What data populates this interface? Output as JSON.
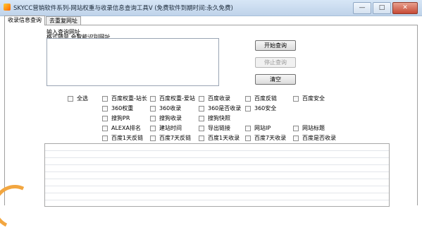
{
  "window": {
    "title": "SKYCC营销软件系列-网站权重与收录信息查询工具V (免费软件到期时间:永久免费)",
    "minimize": "—",
    "maximize": "□",
    "close": "✕"
  },
  "tabs": [
    "收录信息查询",
    "去重复网址"
  ],
  "input": {
    "label": "输入查询网址",
    "hint": "格式随意,会智能识别网址",
    "value": ""
  },
  "buttons": {
    "start": "开始查询",
    "stop": "停止查询",
    "clear": "清空"
  },
  "checkboxes": {
    "select_all": "全选",
    "items": [
      "百度权重-站长",
      "百度权重-爱站",
      "百度收录",
      "百度反链",
      "百度安全",
      "360权重",
      "360收录",
      "360是否收录",
      "360安全",
      "搜狗PR",
      "搜狗收录",
      "搜狗快照",
      "ALEXA排名",
      "建站时间",
      "导出链接",
      "网站IP",
      "网站标题",
      "百度1天反链",
      "百度7天反链",
      "百度1天收录",
      "百度7天收录",
      "百度是否收录"
    ]
  },
  "results": []
}
